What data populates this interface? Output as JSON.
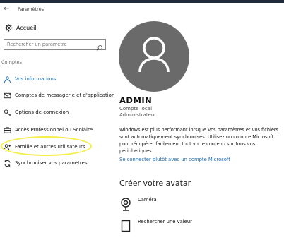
{
  "app": {
    "title": "Paramètres"
  },
  "sidebar": {
    "home_label": "Accueil",
    "search_placeholder": "Rechercher un paramètre",
    "section_label": "Comptes",
    "items": [
      {
        "label": "Vos informations",
        "icon": "user-info-icon",
        "active": true
      },
      {
        "label": "Comptes de messagerie et d'application",
        "icon": "mail-icon",
        "active": false
      },
      {
        "label": "Options de connexion",
        "icon": "key-icon",
        "active": false
      },
      {
        "label": "Accès Professionnel ou Scolaire",
        "icon": "briefcase-icon",
        "active": false
      },
      {
        "label": "Famille et autres utilisateurs",
        "icon": "add-user-icon",
        "active": false
      },
      {
        "label": "Synchroniser vos paramètres",
        "icon": "sync-icon",
        "active": false
      }
    ]
  },
  "profile": {
    "name": "ADMIN",
    "account_type": "Compte local",
    "role": "Administrateur",
    "info_text": "Windows est plus performant lorsque vos paramètres et vos fichiers sont automatiquement synchronisés. Utilisez un compte Microsoft pour récupérer facilement tout votre contenu sur tous vos périphériques.",
    "ms_link": "Se connecter plutôt avec un compte Microsoft"
  },
  "avatar_section": {
    "heading": "Créer votre avatar",
    "options": [
      {
        "label": "Caméra",
        "icon": "camera-icon"
      },
      {
        "label": "Rechercher une valeur",
        "icon": "browse-icon"
      }
    ]
  },
  "colors": {
    "accent": "#1e6db7",
    "highlight": "#f3ee4a",
    "avatar_bg": "#6a6a6a"
  }
}
